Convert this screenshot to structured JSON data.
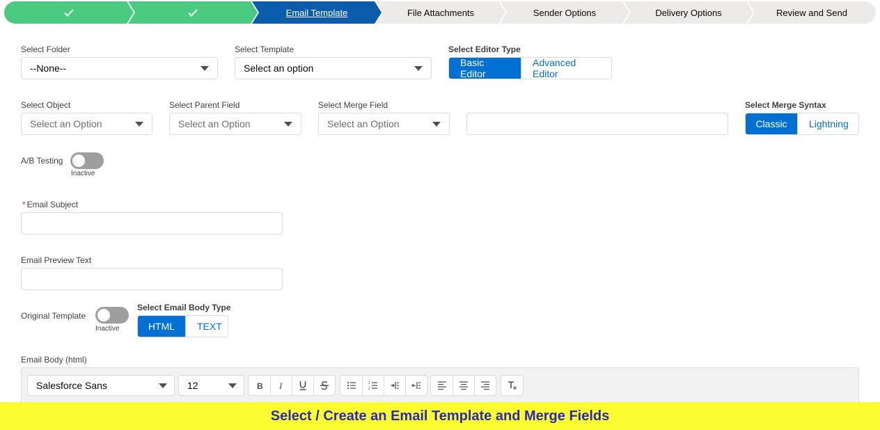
{
  "path": {
    "steps": [
      {
        "label": "",
        "state": "complete"
      },
      {
        "label": "",
        "state": "complete"
      },
      {
        "label": "Email Template",
        "state": "current"
      },
      {
        "label": "File Attachments",
        "state": "incomplete"
      },
      {
        "label": "Sender Options",
        "state": "incomplete"
      },
      {
        "label": "Delivery Options",
        "state": "incomplete"
      },
      {
        "label": "Review and Send",
        "state": "incomplete"
      }
    ],
    "colors": {
      "complete": "#4bca81",
      "current": "#0b5cab",
      "incomplete": "#ecebea"
    }
  },
  "folder": {
    "label": "Select Folder",
    "value": "--None--"
  },
  "template": {
    "label": "Select Template",
    "value": "Select an option"
  },
  "editor_type": {
    "label": "Select Editor Type",
    "options": [
      "Basic Editor",
      "Advanced Editor"
    ],
    "selected": "Basic Editor"
  },
  "object": {
    "label": "Select Object",
    "placeholder": "Select an Option"
  },
  "parent_field": {
    "label": "Select Parent Field",
    "placeholder": "Select an Option"
  },
  "merge_field": {
    "label": "Select Merge Field",
    "placeholder": "Select an Option"
  },
  "merge_syntax": {
    "label": "Select Merge Syntax",
    "options": [
      "Classic",
      "Lightning"
    ],
    "selected": "Classic"
  },
  "ab_testing": {
    "label": "A/B Testing",
    "state": "Inactive"
  },
  "email_subject": {
    "required_mark": "*",
    "label": "Email Subject",
    "value": ""
  },
  "email_preview": {
    "label": "Email Preview Text",
    "value": ""
  },
  "original_template": {
    "label": "Original Template",
    "state": "Inactive"
  },
  "body_type": {
    "label": "Select Email Body Type",
    "options": [
      "HTML",
      "TEXT"
    ],
    "selected": "HTML"
  },
  "email_body": {
    "label": "Email Body (html)",
    "font_family": "Salesforce Sans",
    "font_size": "12",
    "toolbar_icons": [
      "bold-icon",
      "italic-icon",
      "underline-icon",
      "strikethrough-icon",
      "bullet-list-icon",
      "numbered-list-icon",
      "indent-icon",
      "outdent-icon",
      "align-left-icon",
      "align-center-icon",
      "align-right-icon",
      "clear-format-icon"
    ]
  },
  "banner": {
    "text": "Select / Create an Email Template and Merge Fields"
  },
  "colors": {
    "brand": "#0070d2",
    "banner_bg": "#fcfc33",
    "banner_text": "#2a2ab5"
  }
}
